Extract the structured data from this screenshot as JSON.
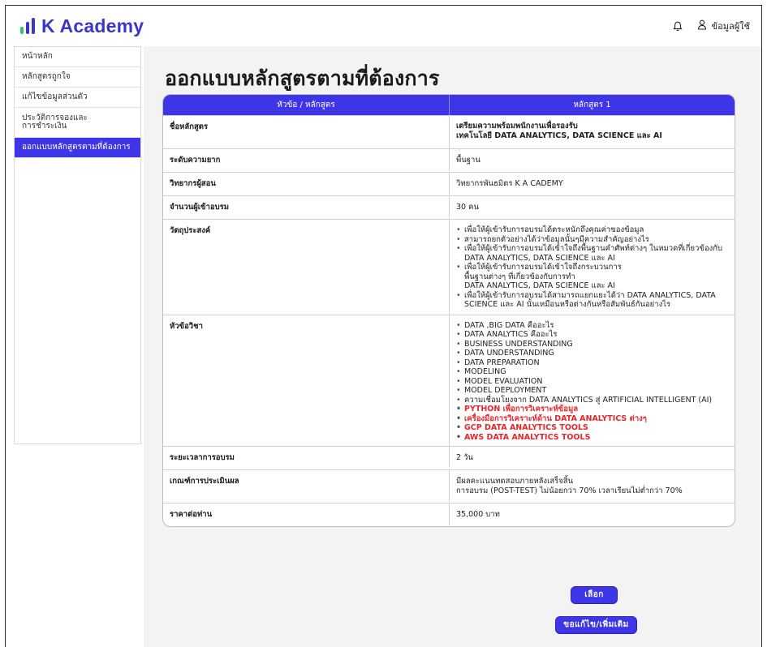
{
  "header": {
    "logo_text": "K Academy",
    "logo_colors": [
      "#35c46a",
      "#3d35c9",
      "#3d35c9"
    ],
    "notification_icon": "bell-icon",
    "user_icon": "user-icon",
    "user_label": "ข้อมูลผู้ใช้"
  },
  "sidebar": {
    "items": [
      {
        "label": "หน้าหลัก"
      },
      {
        "label": "หลักสูตรถูกใจ"
      },
      {
        "label": "แก้ไขข้อมูลส่วนตัว"
      },
      {
        "label": "ประวัติการจองและ\nการชำระเงิน"
      },
      {
        "label": "ออกแบบหลักสูตรตามที่ต้องการ"
      }
    ],
    "active_index": 4
  },
  "main": {
    "title": "ออกแบบหลักสูตรตามที่ต้องการ",
    "table": {
      "header_topic": "หัวข้อ / หลักสูตร",
      "header_course": "หลักสูตร 1",
      "rows": {
        "name": {
          "label": "ชื่อหลักสูตร",
          "value_line1": "เตรียมความพร้อมพนักงานเพื่อรองรับ",
          "value_line2": "เทคโนโลยี DATA ANALYTICS, DATA SCIENCE และ AI"
        },
        "level": {
          "label": "ระดับความยาก",
          "value": "พื้นฐาน"
        },
        "instructor": {
          "label": "วิทยากรผู้สอน",
          "value": "วิทยากรพันธมิตร K A CADEMY"
        },
        "participants": {
          "label": "จำนวนผู้เข้าอบรม",
          "value": "30 คน"
        },
        "objectives": {
          "label": "วัตถุประสงค์",
          "items": [
            "เพื่อให้ผู้เข้ารับการอบรมได้ตระหนักถึงคุณค่าของข้อมูล",
            "สามารถยกตัวอย่างได้ว่าข้อมูลนั้นๆมีความสำคัญอย่างไร",
            "เพื่อให้ผู้เข้ารับการอบรมได้เข้าใจถึงพื้นฐานคำศัพท์ต่างๆ ในหมวดที่เกี่ยวข้องกับ\nDATA ANALYTICS, DATA SCIENCE และ AI",
            "เพื่อให้ผู้เข้ารับการอบรมได้เข้าใจถึงกระบวนการ\nพื้นฐานต่างๆ ที่เกี่ยวข้องกับการทำ\nDATA ANALYTICS, DATA SCIENCE และ AI",
            "เพื่อให้ผู้เข้ารับการอบรมได้สามารถแยกแยะได้ว่า DATA ANALYTICS, DATA\nSCIENCE และ AI นั้นเหมือนหรือต่างกันหรือสัมพันธ์กันอย่างไร"
          ]
        },
        "topics": {
          "label": "หัวข้อวิชา",
          "items": [
            {
              "text": "DATA ,BIG DATA คืออะไร",
              "highlight": false
            },
            {
              "text": "DATA ANALYTICS คืออะไร",
              "highlight": false
            },
            {
              "text": "BUSINESS UNDERSTANDING",
              "highlight": false
            },
            {
              "text": "DATA UNDERSTANDING",
              "highlight": false
            },
            {
              "text": "DATA PREPARATION",
              "highlight": false
            },
            {
              "text": "MODELING",
              "highlight": false
            },
            {
              "text": "MODEL EVALUATION",
              "highlight": false
            },
            {
              "text": "MODEL DEPLOYMENT",
              "highlight": false
            },
            {
              "text": "ความเชื่อมโยงจาก DATA ANALYTICS สู่ ARTIFICIAL INTELLIGENT (AI)",
              "highlight": false
            },
            {
              "text": "PYTHON เพื่อการวิเคราะห์ข้อมูล",
              "highlight": true
            },
            {
              "text": "เครื่องมือการวิเคราะห์ด้าน DATA ANALYTICS ต่างๆ",
              "highlight": true
            },
            {
              "text": "GCP DATA ANALYTICS TOOLS",
              "highlight": true
            },
            {
              "text": "AWS DATA ANALYTICS TOOLS",
              "highlight": true
            }
          ],
          "highlight_color": "#e8262c"
        },
        "duration": {
          "label": "ระยะเวลาการอบรม",
          "value": "2 วัน"
        },
        "evaluation": {
          "label": "เกณฑ์การประเมินผล",
          "value_line1": "มีผลคะแนนทดสอบภายหลังเสร็จสิ้น",
          "value_line2": "การอบรม (POST-TEST) ไม่น้อยกว่า 70% เวลาเรียนไม่ต่ำกว่า 70%"
        },
        "price": {
          "label": "ราคาต่อท่าน",
          "value": "35,000 บาท"
        }
      }
    },
    "buttons": {
      "select_label": "เลือก",
      "edit_label": "ขอแก้ไข/เพิ่มเติม"
    }
  },
  "colors": {
    "accent": "#3d35e6",
    "logo_text": "#3d35c9",
    "logo_bar_green": "#35c46a",
    "content_bg": "#f3f3f3"
  }
}
